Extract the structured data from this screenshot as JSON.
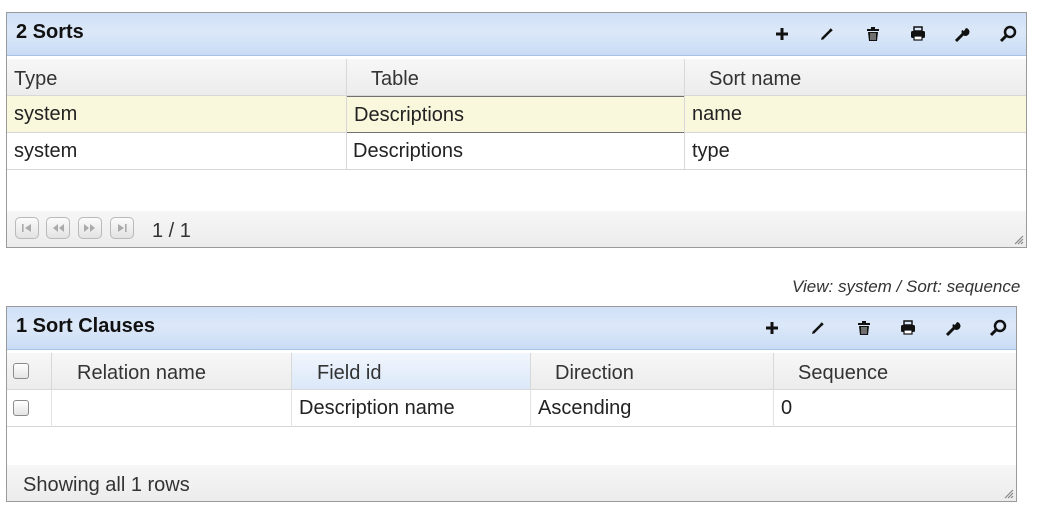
{
  "sorts": {
    "title": "2 Sorts",
    "columns": [
      "Type",
      "Table",
      "Sort name"
    ],
    "rows": [
      {
        "type": "system",
        "table": "Descriptions",
        "sort_name": "name"
      },
      {
        "type": "system",
        "table": "Descriptions",
        "sort_name": "type"
      }
    ],
    "pager": "1 / 1"
  },
  "view_info": "View: system / Sort: sequence",
  "clauses": {
    "title": "1 Sort Clauses",
    "columns": [
      "Relation name",
      "Field id",
      "Direction",
      "Sequence"
    ],
    "rows": [
      {
        "relation_name": "",
        "field_id": "Description name",
        "direction": "Ascending",
        "sequence": "0"
      }
    ],
    "status": "Showing all 1 rows"
  },
  "toolbar_icons": [
    "add-icon",
    "edit-icon",
    "delete-icon",
    "print-icon",
    "settings-icon",
    "search-icon"
  ]
}
